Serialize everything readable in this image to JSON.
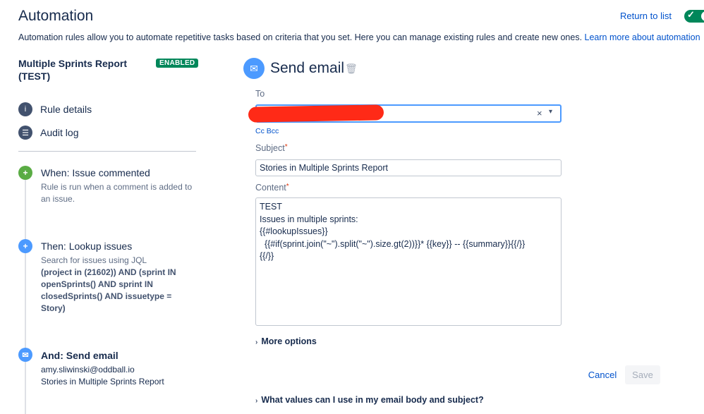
{
  "header": {
    "title": "Automation",
    "return_link": "Return to list",
    "toggle_check": "✓"
  },
  "intro": {
    "text": "Automation rules allow you to automate repetitive tasks based on criteria that you set. Here you can manage existing rules and create new ones. ",
    "link": "Learn more about automation"
  },
  "rule": {
    "name": "Multiple Sprints Report (TEST)",
    "status": "ENABLED"
  },
  "nav": {
    "rule_details": "Rule details",
    "audit_log": "Audit log"
  },
  "steps": {
    "trigger": {
      "title": "When: Issue commented",
      "desc": "Rule is run when a comment is added to an issue."
    },
    "lookup": {
      "title": "Then: Lookup issues",
      "desc_prefix": "Search for issues using JQL",
      "jql": "(project in (21602)) AND (sprint IN openSprints() AND sprint IN closedSprints() AND issuetype = Story)"
    },
    "email": {
      "title": "And: Send email",
      "recipient": "amy.sliwinski@oddball.io",
      "subject": "Stories in Multiple Sprints Report"
    }
  },
  "action": {
    "title": "Send email",
    "to_label": "To",
    "cc_bcc": "Cc Bcc",
    "clear_glyph": "×",
    "caret_glyph": "▾",
    "subject_label": "Subject",
    "subject_value": "Stories in Multiple Sprints Report",
    "content_label": "Content",
    "content_value": "TEST\nIssues in multiple sprints:\n{{#lookupIssues}}\n  {{#if(sprint.join(\"~\").split(\"~\").size.gt(2))}}* {{key}} -- {{summary}}{{/}}\n{{/}}",
    "required_mark": "*",
    "more_options": "More options",
    "cancel": "Cancel",
    "save": "Save",
    "help": "What values can I use in my email body and subject?"
  },
  "colors": {
    "accent": "#0052cc",
    "enabled": "#00875a",
    "trigger": "#5aac44",
    "action": "#4c9aff",
    "redaction": "#ff2a17"
  },
  "icons": {
    "rule_details": "info-icon",
    "audit_log": "list-icon",
    "trigger": "comment-icon",
    "lookup": "plus-icon",
    "email": "envelope-icon",
    "delete": "trash-icon"
  }
}
